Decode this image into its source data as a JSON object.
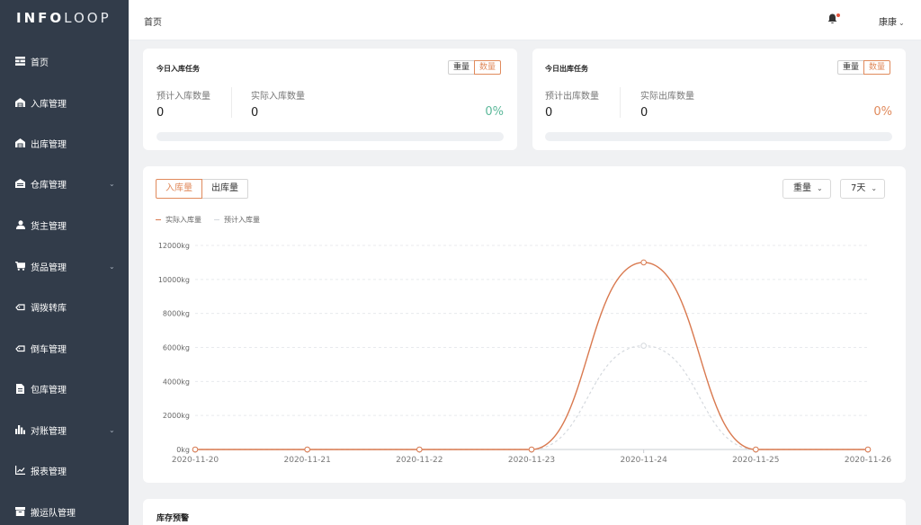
{
  "brand": {
    "bold": "INFO",
    "light": "LOOP"
  },
  "sidebar": {
    "items": [
      {
        "label": "首页",
        "icon": "home-list-icon",
        "has_children": false
      },
      {
        "label": "入库管理",
        "icon": "warehouse-in-icon",
        "has_children": false
      },
      {
        "label": "出库管理",
        "icon": "warehouse-out-icon",
        "has_children": false
      },
      {
        "label": "仓库管理",
        "icon": "warehouse-icon",
        "has_children": true
      },
      {
        "label": "货主管理",
        "icon": "user-icon",
        "has_children": false
      },
      {
        "label": "货品管理",
        "icon": "cart-icon",
        "has_children": true
      },
      {
        "label": "调拨转库",
        "icon": "transfer-icon",
        "has_children": false
      },
      {
        "label": "倒车管理",
        "icon": "reverse-icon",
        "has_children": false
      },
      {
        "label": "包库管理",
        "icon": "document-icon",
        "has_children": false
      },
      {
        "label": "对账管理",
        "icon": "bar-chart-icon",
        "has_children": true
      },
      {
        "label": "报表管理",
        "icon": "line-chart-icon",
        "has_children": false
      },
      {
        "label": "搬运队管理",
        "icon": "box-icon",
        "has_children": false
      }
    ]
  },
  "header": {
    "breadcrumb": "首页",
    "user_name": "康康"
  },
  "inbound_card": {
    "title": "今日入库任务",
    "toggle": {
      "weight": "重量",
      "count": "数量",
      "active": "count"
    },
    "planned_label": "预计入库数量",
    "planned_value": "0",
    "actual_label": "实际入库数量",
    "actual_value": "0",
    "percent": "0%",
    "percent_color": "#5cb89a",
    "progress": 0
  },
  "outbound_card": {
    "title": "今日出库任务",
    "toggle": {
      "weight": "重量",
      "count": "数量",
      "active": "count"
    },
    "planned_label": "预计出库数量",
    "planned_value": "0",
    "actual_label": "实际出库数量",
    "actual_value": "0",
    "percent": "0%",
    "percent_color": "#e08a5c",
    "progress": 0
  },
  "chart_panel": {
    "tabs": [
      "入库量",
      "出库量"
    ],
    "active_tab": "入库量",
    "metric_select": "重量",
    "range_select": "7天"
  },
  "chart_data": {
    "type": "line",
    "x": [
      "2020-11-20",
      "2020-11-21",
      "2020-11-22",
      "2020-11-23",
      "2020-11-24",
      "2020-11-25",
      "2020-11-26"
    ],
    "series": [
      {
        "name": "实际入库量",
        "values": [
          0,
          0,
          0,
          0,
          11000,
          0,
          0
        ],
        "color": "#d9794f"
      },
      {
        "name": "预计入库量",
        "values": [
          0,
          0,
          0,
          0,
          6100,
          0,
          0
        ],
        "color": "#d5d9de"
      }
    ],
    "y_ticks": [
      "0kg",
      "2000kg",
      "4000kg",
      "6000kg",
      "8000kg",
      "10000kg",
      "12000kg"
    ],
    "ylim": [
      0,
      12000
    ],
    "y_unit": "kg",
    "smooth": true,
    "grid": true,
    "legend_position": "top-left"
  },
  "stock_alert": {
    "title": "库存预警"
  }
}
